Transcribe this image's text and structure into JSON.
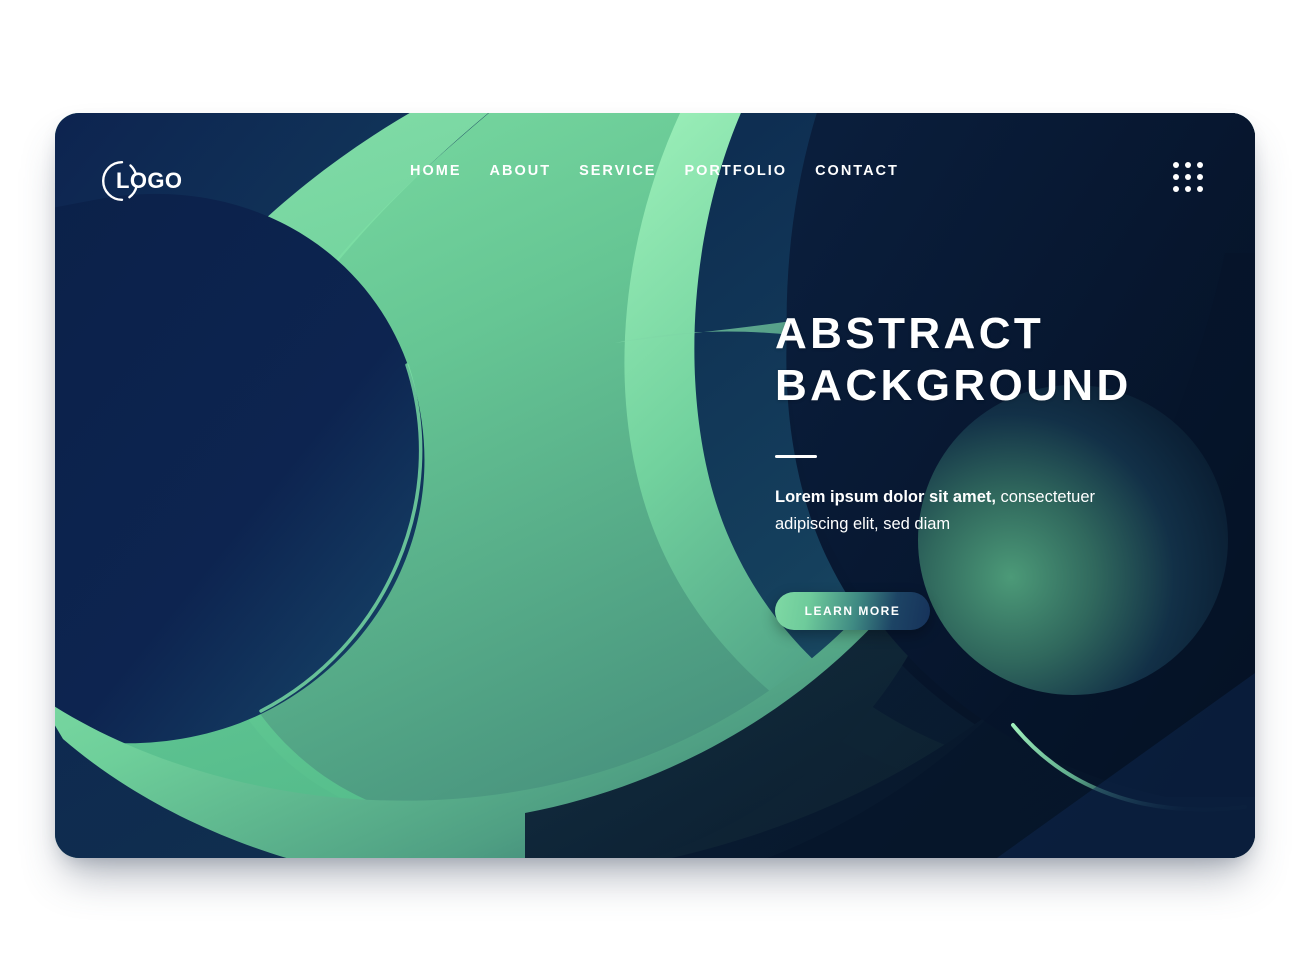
{
  "page": {
    "background_color": "#ffffff",
    "card_radius_px": 24
  },
  "brand": {
    "logo_text": "LOGO",
    "logo_icon": "circle-outline-icon"
  },
  "nav": {
    "items": [
      {
        "label": "HOME"
      },
      {
        "label": "ABOUT"
      },
      {
        "label": "SERVICE"
      },
      {
        "label": "PORTFOLIO"
      },
      {
        "label": "CONTACT"
      }
    ],
    "menu_icon": "grid-dots-icon"
  },
  "hero": {
    "title": "ABSTRACT\nBACKGROUND",
    "paragraph_lead": "Lorem ipsum dolor sit amet,",
    "paragraph_rest": " consectetuer adipiscing elit, sed diam",
    "cta_label": "LEARN MORE"
  },
  "palette": {
    "green_light": "#7fe0a5",
    "green_mid": "#65c392",
    "green_muted": "#4a9c7d",
    "teal_deep": "#2c6a6e",
    "navy": "#0d2450",
    "navy_deep": "#061429",
    "navy_mid": "#123056",
    "white": "#ffffff"
  }
}
